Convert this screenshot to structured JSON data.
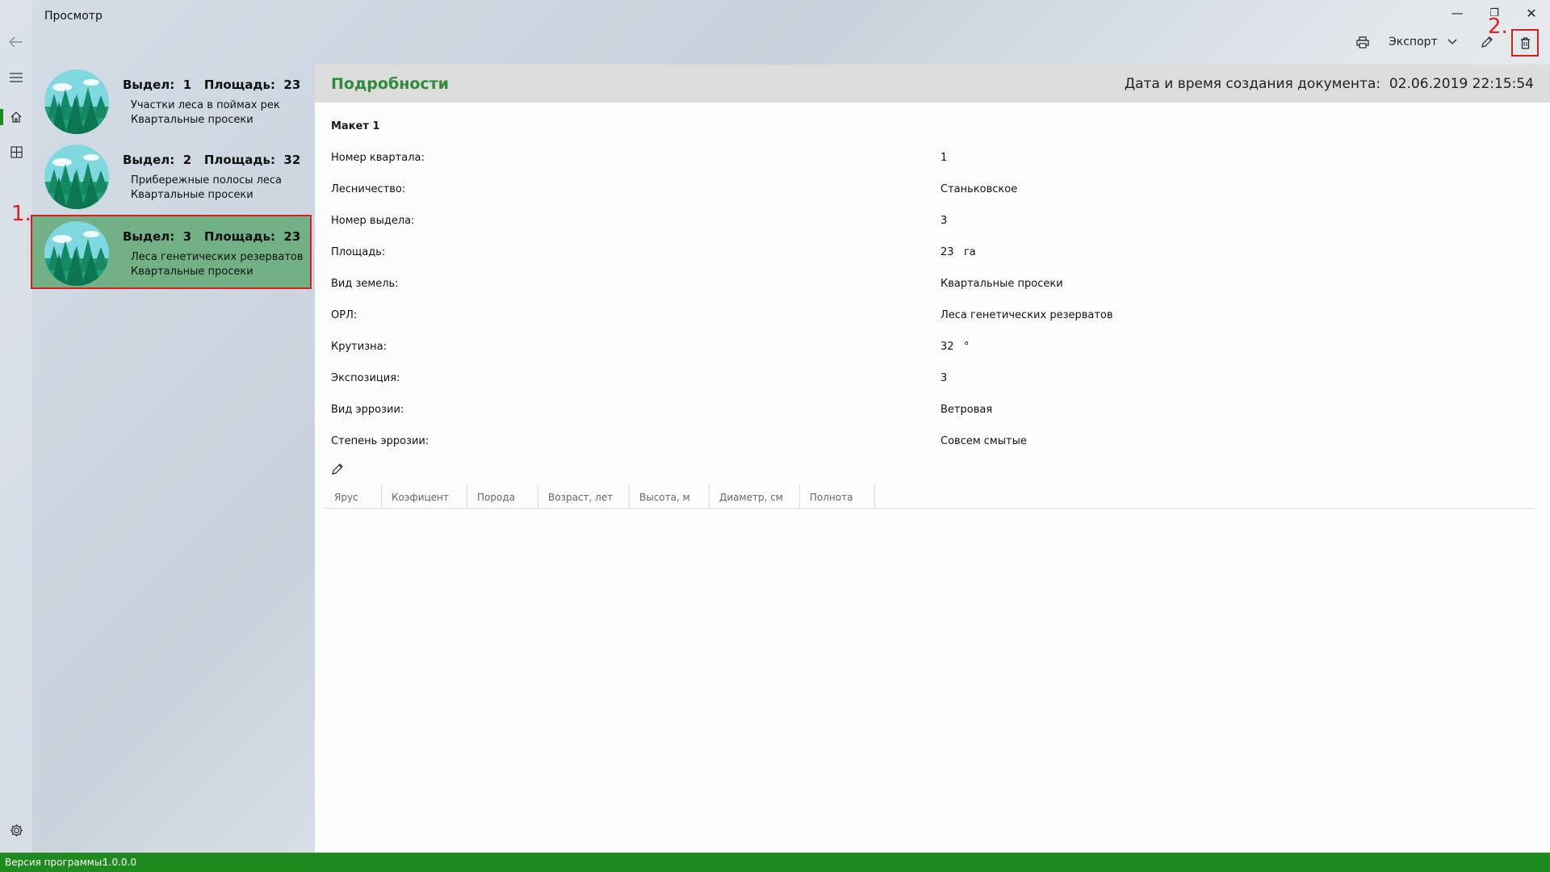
{
  "window": {
    "title": "Просмотр",
    "minimize_glyph": "—",
    "maximize_glyph": "❐",
    "close_glyph": "✕"
  },
  "nav": {
    "back_icon": "arrow-left-icon",
    "menu_icon": "hamburger-icon",
    "home_icon": "home-icon",
    "grid_icon": "grid-icon",
    "settings_icon": "gear-icon"
  },
  "commands": {
    "print_icon": "printer-icon",
    "export_label": "Экспорт",
    "edit_icon": "pencil-icon",
    "delete_icon": "trash-icon"
  },
  "annotations": {
    "one": "1.",
    "two": "2."
  },
  "list": {
    "items": [
      {
        "title": "Выдел:  1   Площадь:  23",
        "line1": "Участки леса в поймах рек",
        "line2": "Квартальные просеки",
        "selected": false
      },
      {
        "title": "Выдел:  2   Площадь:  32",
        "line1": "Прибережные полосы леса",
        "line2": "Квартальные просеки",
        "selected": false
      },
      {
        "title": "Выдел:  3   Площадь:  23",
        "line1": "Леса генетических резерватов",
        "line2": "Квартальные просеки",
        "selected": true
      }
    ]
  },
  "detail": {
    "title": "Подробности",
    "created": "Дата и время создания документа:  02.06.2019 22:15:54",
    "maket": "Макет 1",
    "fields": [
      {
        "label": "Номер квартала:",
        "value": "1"
      },
      {
        "label": "Лесничество:",
        "value": "Станьковское"
      },
      {
        "label": "Номер выдела:",
        "value": "3"
      },
      {
        "label": "Площадь:",
        "value": "23   га"
      },
      {
        "label": "Вид земель:",
        "value": "Квартальные просеки"
      },
      {
        "label": "ОРЛ:",
        "value": "Леса генетических резерватов"
      },
      {
        "label": "Крутизна:",
        "value": "32   °"
      },
      {
        "label": "Экспозиция:",
        "value": "3"
      },
      {
        "label": "Вид эррозии:",
        "value": "Ветровая"
      },
      {
        "label": "Степень эррозии:",
        "value": "Совсем смытые"
      }
    ],
    "table_headers": [
      "Ярус",
      "Коэфицент",
      "Порода",
      "Возраст, лет",
      "Высота, м",
      "Диаметр, см",
      "Полнота"
    ]
  },
  "status": {
    "label": "Версия программы:",
    "version": "1.0.0.0"
  },
  "colors": {
    "accent": "#1f8a1f",
    "title_green": "#2e8b3a",
    "selection": "#4ca060",
    "annotation_red": "#d61f1f"
  }
}
